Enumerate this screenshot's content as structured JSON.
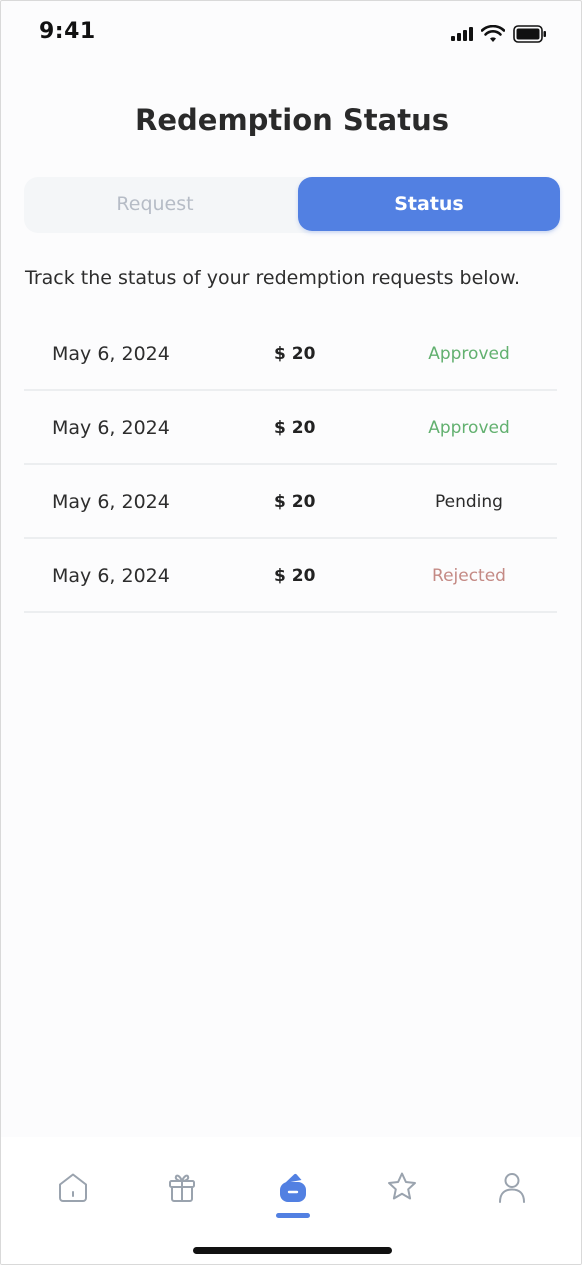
{
  "status_bar": {
    "time": "9:41"
  },
  "header": {
    "title": "Redemption Status"
  },
  "segmented": {
    "request_label": "Request",
    "status_label": "Status",
    "active": "Status"
  },
  "subtitle": "Track the status of your redemption requests below.",
  "requests": [
    {
      "date": "May 6, 2024",
      "amount": "$ 20",
      "status": "Approved"
    },
    {
      "date": "May 6, 2024",
      "amount": "$ 20",
      "status": "Approved"
    },
    {
      "date": "May 6, 2024",
      "amount": "$ 20",
      "status": "Pending"
    },
    {
      "date": "May 6, 2024",
      "amount": "$ 20",
      "status": "Rejected"
    }
  ],
  "tabbar": {
    "items": [
      {
        "icon": "home-icon"
      },
      {
        "icon": "gift-icon"
      },
      {
        "icon": "wallet-icon",
        "active": true
      },
      {
        "icon": "star-icon"
      },
      {
        "icon": "user-icon"
      }
    ]
  },
  "colors": {
    "accent": "#5280e2",
    "approved": "#62b06f",
    "pending": "#2a2a2a",
    "rejected": "#c48a85"
  }
}
